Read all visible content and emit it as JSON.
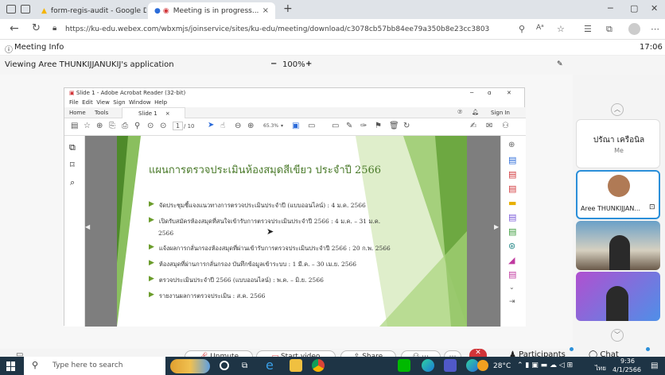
{
  "browser": {
    "tabs": [
      {
        "title": "form-regis-audit - Google Drive",
        "close": "×"
      },
      {
        "title": "Meeting is in progress...",
        "close": "×"
      }
    ],
    "new_tab": "+",
    "url": "https://ku-edu.webex.com/wbxmjs/joinservice/sites/ku-edu/meeting/download/c3078cb57bb84ee79a350b8e23cc3803"
  },
  "meeting": {
    "info_label": "Meeting Info",
    "time": "17:06",
    "viewing": "Viewing Aree THUNKIJJANUKIJ's application",
    "zoom_minus": "−",
    "zoom": "100%",
    "zoom_plus": "+"
  },
  "acrobat": {
    "title": "Slide 1 - Adobe Acrobat Reader (32-bit)",
    "menu": [
      "File",
      "Edit",
      "View",
      "Sign",
      "Window",
      "Help"
    ],
    "tabs": [
      "Home",
      "Tools",
      "Slide 1"
    ],
    "signin": "Sign In",
    "page_current": "1",
    "page_total": "/ 10",
    "zoom": "65.3%"
  },
  "slide": {
    "title": "แผนการตรวจประเมินห้องสมุดสีเขียว ประจำปี 2566",
    "bullets": [
      "จัดประชุมชี้แจงแนวทางการตรวจประเมินประจำปี (แบบออนไลน์) : 4 ม.ค. 2566",
      "เปิดรับสมัครห้องสมุดที่สนใจเข้ารับการตรวจประเมินประจำปี 2566 : 4 ม.ค. – 31 ม.ค.",
      "2566",
      "แจ้งผลการกลั่นกรองห้องสมุดที่ผ่านเข้ารับการตรวจประเมินประจำปี 2566 : 20 ก.พ. 2566",
      "ห้องสมุดที่ผ่านการกลั่นกรอง บันทึกข้อมูลเข้าระบบ : 1 มี.ค. – 30 เม.ย. 2566",
      "ตรวจประเมินประจำปี 2566 (แบบออนไลน์) : พ.ค. – มิ.ย. 2566",
      "รายงานผลการตรวจประเมิน : ส.ค. 2566"
    ]
  },
  "participants": {
    "self_name": "ปรัณา เครือนิล",
    "self_sub": "Me",
    "presenter": "Aree THUNKIJJAN..."
  },
  "controls": {
    "unmute": "Unmute",
    "start_video": "Start video",
    "share": "Share",
    "participants": "Participants",
    "chat": "Chat"
  },
  "taskbar": {
    "search_placeholder": "Type here to search",
    "temp": "28°C",
    "lang": "ไทย",
    "time": "9:36",
    "date": "4/1/2566"
  }
}
